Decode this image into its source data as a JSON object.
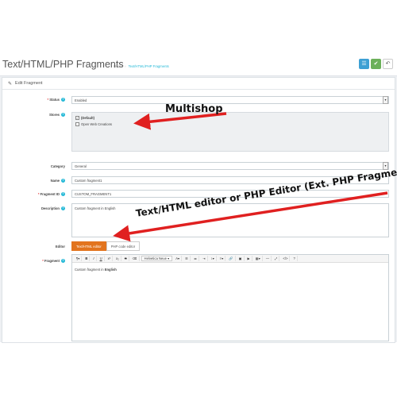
{
  "header": {
    "title": "Text/HTML/PHP Fragments",
    "breadcrumb": [
      "Home",
      "Text/HTML/PHP Fragments"
    ],
    "buttons": [
      {
        "icon": "list-icon",
        "color": "#3da0d4"
      },
      {
        "icon": "check-icon",
        "color": "#6cb05a"
      },
      {
        "icon": "back-icon",
        "color": "#ffffff"
      }
    ]
  },
  "panel": {
    "heading": "Edit Fragment",
    "status": {
      "label": "Status",
      "value": "Enabled"
    },
    "stores": {
      "label": "Stores",
      "items": [
        {
          "label": "(Default)",
          "checked": true
        },
        {
          "label": "Open Web Creations",
          "checked": false
        }
      ]
    },
    "category": {
      "label": "Category",
      "value": "General"
    },
    "name": {
      "label": "Name",
      "value": "Custom fragment1"
    },
    "fragment_id": {
      "label": "Fragment ID",
      "value": "CUSTOM_FRAGMENT1"
    },
    "description": {
      "label": "Description",
      "value": "Custom fragment in English"
    },
    "editor": {
      "label": "Editor",
      "options": [
        "Text/HTML editor",
        "PHP code editor"
      ],
      "selected": "Text/HTML editor"
    },
    "fragment": {
      "label": "Fragment",
      "toolbar_font": "Helvetica Neue",
      "content_prefix": "Custom fragment in ",
      "content_bold": "English"
    }
  },
  "annotations": {
    "multishop": "Multishop",
    "editor_note": "Text/HTML editor or PHP Editor (Ext. PHP Fragments)",
    "arrow_color": "#e02020"
  }
}
